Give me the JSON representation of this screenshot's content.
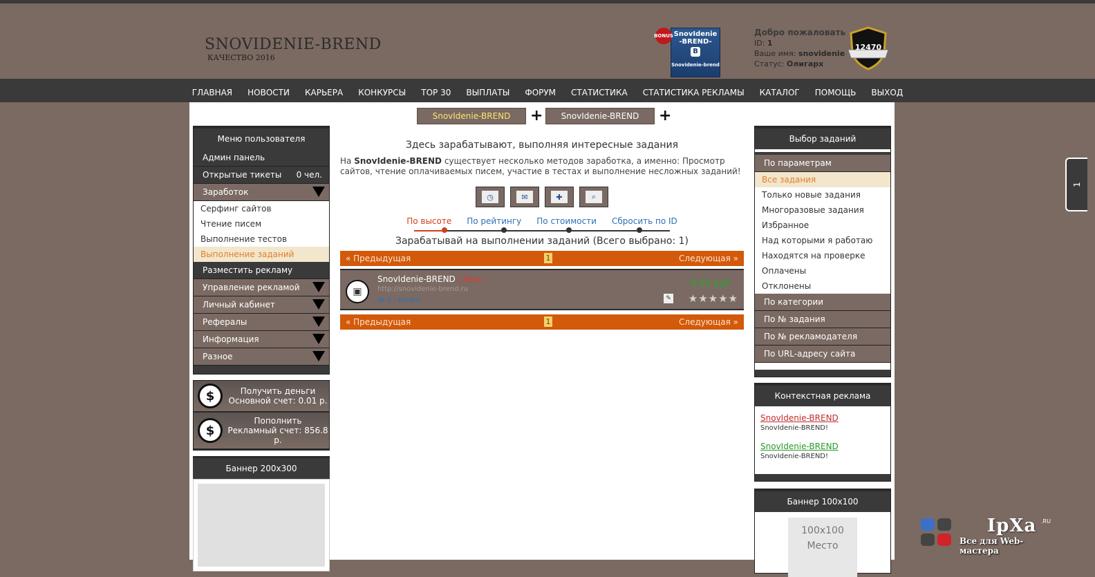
{
  "header": {
    "site_name": "SNOVIDENIE-BREND",
    "site_sub": "КАЧЕСТВО 2016",
    "bonus_badge": "BONUS",
    "banner_top": "SnovIdenie",
    "banner_mid": "-BREND-",
    "banner_letter": "B",
    "banner_bottom": "Snovidenie-brend",
    "welcome_title": "Добро пожаловать",
    "id_label": "ID:",
    "id_value": "1",
    "name_label": "Ваше имя:",
    "name_value": "snovidenie",
    "status_label": "Статус:",
    "status_value": "Олигарх",
    "shield_number": "12470"
  },
  "nav": [
    "ГЛАВНАЯ",
    "НОВОСТИ",
    "КАРЬЕРА",
    "КОНКУРСЫ",
    "TOP 30",
    "ВЫПЛАТЫ",
    "ФОРУМ",
    "СТАТИСТИКА",
    "СТАТИСТИКА РЕКЛАМЫ",
    "КАТАЛОГ",
    "ПОМОЩЬ",
    "ВЫХОД"
  ],
  "top_tabs": [
    "SnovIdenie-BREND",
    "SnovIdenie-BREND"
  ],
  "plus_sign": "+",
  "left_menu": {
    "title": "Меню пользователя",
    "admin": "Админ панель",
    "tickets": "Открытые тикеты",
    "tickets_count": "0 чел.",
    "earn": "Заработок",
    "sub_items": [
      "Серфинг сайтов",
      "Чтение писем",
      "Выполнение тестов",
      "Выполнение заданий"
    ],
    "place_ad": "Разместить рекламу",
    "sections": [
      "Управление рекламой",
      "Личный кабинет",
      "Рефералы",
      "Информация",
      "Разное"
    ]
  },
  "money": {
    "get_label": "Получить деньги",
    "get_account": "Основной счет: 0.01 р.",
    "topup_label": "Пополнить",
    "topup_account": "Рекламный счет: 856.8 р.",
    "icon": "$"
  },
  "left_banner": {
    "title": "Баннер 200x300"
  },
  "center": {
    "title": "Здесь зарабатывают, выполняя интересные задания",
    "desc_prefix": "На ",
    "desc_brand": "SnovIdenie-BREND",
    "desc_rest": " существует несколько методов заработка, а именно: Просмотр сайтов, чтение оплачиваемых писем, участие в тестах и выполнение несложных заданий!",
    "sorts": [
      "По высоте",
      "По рейтингу",
      "По стоимости",
      "Сбросить по ID"
    ],
    "earn_line": "Зарабатывай на выполнении заданий (Всего выбрано: 1)",
    "prev": "« Предыдущая",
    "next": "Следующая »",
    "page": "1",
    "task": {
      "name": "SnovIdenie-BREND",
      "new": "( New )",
      "url": "http://snovidenie-brend.ru",
      "clicks": "№ 2 - клики",
      "price": "0.20 руб",
      "stars": "★★★★★"
    }
  },
  "right_menu": {
    "title": "Выбор заданий",
    "params": "По параметрам",
    "items": [
      "Все задания",
      "Только новые задания",
      "Многоразовые задания",
      "Избранное",
      "Над которыми я работаю",
      "Находятся на проверке",
      "Оплачены",
      "Отклонены"
    ],
    "sections": [
      "По категории",
      "По № задания",
      "По № рекламодателя",
      "По URL-адресу сайта"
    ]
  },
  "context_ads": {
    "title": "Контекстная реклама",
    "ads": [
      {
        "link": "SnovIdenie-BREND",
        "text": "SnovIdenie-BREND!"
      },
      {
        "link": "SnovIdenie-BREND",
        "text": "SnovIdenie-BREND!"
      }
    ]
  },
  "right_banner": {
    "title": "Баннер 100x100",
    "placeholder_size": "100x100",
    "placeholder_word": "Место"
  },
  "side_tab": "1",
  "watermark": {
    "name": "IpXa",
    "ru": ".RU",
    "tagline": "Все для Web-мастера"
  }
}
